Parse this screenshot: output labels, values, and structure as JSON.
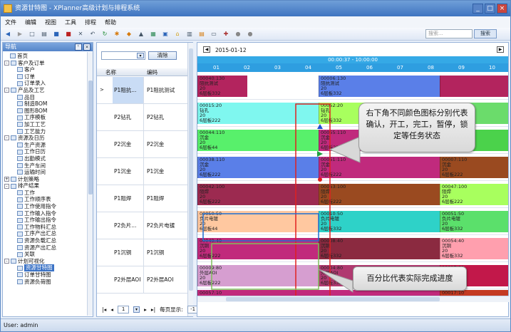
{
  "window": {
    "title": "资源甘特图 - XPlanner高级计划与排程系统"
  },
  "menu": [
    "文件",
    "编辑",
    "视图",
    "工具",
    "排程",
    "帮助"
  ],
  "toolbar": {
    "search_placeholder": "搜索...",
    "search_button": "搜索"
  },
  "nav": {
    "title": "导航",
    "items": [
      {
        "label": "首页",
        "level": 1,
        "expand": ""
      },
      {
        "label": "客户及订单",
        "level": 0,
        "expand": "-"
      },
      {
        "label": "客户",
        "level": 2,
        "expand": ""
      },
      {
        "label": "订单",
        "level": 2,
        "expand": ""
      },
      {
        "label": "订单录入",
        "level": 2,
        "expand": ""
      },
      {
        "label": "产品及工艺",
        "level": 0,
        "expand": "-"
      },
      {
        "label": "品目",
        "level": 2,
        "expand": ""
      },
      {
        "label": "制造BOM",
        "level": 2,
        "expand": ""
      },
      {
        "label": "图形BOM",
        "level": 2,
        "expand": ""
      },
      {
        "label": "工序模板",
        "level": 2,
        "expand": ""
      },
      {
        "label": "加工工艺",
        "level": 2,
        "expand": ""
      },
      {
        "label": "工艺能力",
        "level": 2,
        "expand": ""
      },
      {
        "label": "资源及日历",
        "level": 0,
        "expand": "-"
      },
      {
        "label": "生产资源",
        "level": 2,
        "expand": ""
      },
      {
        "label": "工作日历",
        "level": 2,
        "expand": ""
      },
      {
        "label": "出勤模式",
        "level": 2,
        "expand": ""
      },
      {
        "label": "生产车间",
        "level": 2,
        "expand": ""
      },
      {
        "label": "运输时间",
        "level": 2,
        "expand": ""
      },
      {
        "label": "计划策略",
        "level": 0,
        "expand": "+"
      },
      {
        "label": "排产结果",
        "level": 0,
        "expand": "-"
      },
      {
        "label": "工作",
        "level": 2,
        "expand": ""
      },
      {
        "label": "工作顺序表",
        "level": 2,
        "expand": ""
      },
      {
        "label": "工作使用指令",
        "level": 2,
        "expand": ""
      },
      {
        "label": "工作输入指令",
        "level": 2,
        "expand": ""
      },
      {
        "label": "工作输出指令",
        "level": 2,
        "expand": ""
      },
      {
        "label": "工作物料汇总",
        "level": 2,
        "expand": ""
      },
      {
        "label": "工序产出汇总",
        "level": 2,
        "expand": ""
      },
      {
        "label": "资源负载汇总",
        "level": 2,
        "expand": ""
      },
      {
        "label": "资源产出汇总",
        "level": 2,
        "expand": ""
      },
      {
        "label": "关联",
        "level": 2,
        "expand": ""
      },
      {
        "label": "计划可视化",
        "level": 0,
        "expand": "-"
      },
      {
        "label": "资源甘特图",
        "level": 2,
        "expand": "",
        "selected": true
      },
      {
        "label": "订单甘特图",
        "level": 2,
        "expand": ""
      },
      {
        "label": "资源负荷图",
        "level": 2,
        "expand": ""
      }
    ]
  },
  "grid": {
    "clear_button": "清除",
    "col_name": "名称",
    "col_code": "编码",
    "rows": [
      {
        "name": "P1阻抗...",
        "code": "P1阻抗测试",
        "selected": true
      },
      {
        "name": "P2钻孔",
        "code": "P2钻孔"
      },
      {
        "name": "P2沉金",
        "code": "P2沉金"
      },
      {
        "name": "P1沉金",
        "code": "P1沉金"
      },
      {
        "name": "P1阻焊",
        "code": "P1阻焊"
      },
      {
        "name": "P2负片...",
        "code": "P2负片电镀"
      },
      {
        "name": "P1沉铜",
        "code": "P1沉铜"
      },
      {
        "name": "P2外层AOI",
        "code": "P2外层AOI"
      }
    ]
  },
  "pager": {
    "first": "|◂",
    "prev": "◂",
    "page": "1",
    "next": "▸",
    "last": "▸|",
    "page_size_label": "每页显示:",
    "page_size": "-1"
  },
  "gantt": {
    "date": "2015-01-12",
    "range": "00:00:37 - 10:00:00",
    "hours": [
      "01",
      "02",
      "03",
      "04",
      "05",
      "06",
      "07",
      "08",
      "09",
      "10"
    ],
    "lanes": [
      [
        {
          "l": 0,
          "w": 70,
          "c": "#b3245e",
          "id": "00040:130",
          "n": "阻抗测试",
          "q": "20",
          "p": "6层板332"
        },
        {
          "l": 170,
          "w": 170,
          "c": "#5a7fe8",
          "id": "00006:130",
          "n": "阻抗测试",
          "q": "20",
          "p": "6层板332"
        },
        {
          "l": 340,
          "w": 96,
          "c": "#b3245e",
          "id": "",
          "n": "",
          "q": "",
          "p": ""
        }
      ],
      [
        {
          "l": 0,
          "w": 170,
          "c": "#7ff7ef",
          "id": "00015:20",
          "n": "钻孔",
          "q": "20",
          "p": "6层板222"
        },
        {
          "l": 170,
          "w": 170,
          "c": "#a8ff5e",
          "id": "00052:20",
          "n": "钻孔",
          "q": "20",
          "p": "6层板332"
        },
        {
          "l": 340,
          "w": 96,
          "c": "#6bdc6b",
          "id": "",
          "n": "",
          "q": "",
          "p": ""
        }
      ],
      [
        {
          "l": 0,
          "w": 170,
          "c": "#58f06b",
          "id": "00044:110",
          "n": "沉金",
          "q": "20",
          "p": "6层板44"
        },
        {
          "l": 170,
          "w": 170,
          "c": "#c02a7d",
          "id": "00055:110",
          "n": "沉金",
          "q": "20",
          "p": "6层板222"
        },
        {
          "l": 340,
          "w": 96,
          "c": "#4bd24b",
          "id": "",
          "n": "",
          "q": "",
          "p": "6层板44"
        }
      ],
      [
        {
          "l": 0,
          "w": 170,
          "c": "#5a7fe8",
          "id": "00038:110",
          "n": "沉金",
          "q": "20",
          "p": "6层板222"
        },
        {
          "l": 170,
          "w": 170,
          "c": "#c02a7d",
          "id": "00051:110",
          "n": "沉金",
          "q": "20",
          "p": "6层板222"
        },
        {
          "l": 340,
          "w": 96,
          "c": "#9a4a20",
          "id": "00007:110",
          "n": "沉金",
          "q": "20",
          "p": "6层板222"
        }
      ],
      [
        {
          "l": 0,
          "w": 170,
          "c": "#9c2a50",
          "id": "00042:100",
          "n": "阻焊",
          "q": "20",
          "p": "6层板222"
        },
        {
          "l": 170,
          "w": 170,
          "c": "#9a4a20",
          "id": "00053:100",
          "n": "阻焊",
          "q": "20",
          "p": "6层板222"
        },
        {
          "l": 340,
          "w": 96,
          "c": "#a8ff5e",
          "id": "00047:100",
          "n": "阻焊",
          "q": "20",
          "p": "6层板222"
        }
      ],
      [
        {
          "l": 0,
          "w": 170,
          "c": "#ffc8a0",
          "id": "00050:50",
          "n": "负片电镀",
          "q": "20",
          "p": "6层板44"
        },
        {
          "l": 170,
          "w": 170,
          "c": "#2ed2c8",
          "id": "00010:50",
          "n": "负片电镀",
          "q": "20",
          "p": "6层板332"
        },
        {
          "l": 340,
          "w": 96,
          "c": "#5be06b",
          "id": "00051:50",
          "n": "负片电镀",
          "q": "20",
          "p": "6层板332"
        }
      ],
      [
        {
          "l": 0,
          "w": 170,
          "c": "#c12a7c",
          "id": "00049:40",
          "n": "沉铜",
          "q": "20",
          "p": "6层板222"
        },
        {
          "l": 170,
          "w": 170,
          "c": "#8b2a40",
          "id": "00008:40",
          "n": "沉铜",
          "q": "20",
          "p": "6层板332"
        },
        {
          "l": 340,
          "w": 96,
          "c": "#ff9fae",
          "id": "00054:40",
          "n": "沉铜",
          "q": "20",
          "p": "6层板332"
        }
      ],
      [
        {
          "l": 0,
          "w": 170,
          "c": "#d69ed0",
          "id": "00009:80",
          "n": "外层AOI",
          "q": "20",
          "p": "6层板222"
        },
        {
          "l": 170,
          "w": 170,
          "c": "#b03a70",
          "id": "00004:80",
          "n": "外层AOI",
          "q": "20",
          "p": "6层板332"
        },
        {
          "l": 340,
          "w": 96,
          "c": "#c2184a",
          "id": "00017:80",
          "n": "外层AOI",
          "q": "20",
          "p": "6层板222"
        }
      ]
    ],
    "bottom_label_left": "00057:10",
    "bottom_label_right": "00017:10"
  },
  "callouts": {
    "status": "右下角不同颜色图标分别代表确认，开工，完工，暂停，锁定等任务状态",
    "progress": "百分比代表实际完成进度"
  },
  "status": {
    "user": "User: admin"
  }
}
